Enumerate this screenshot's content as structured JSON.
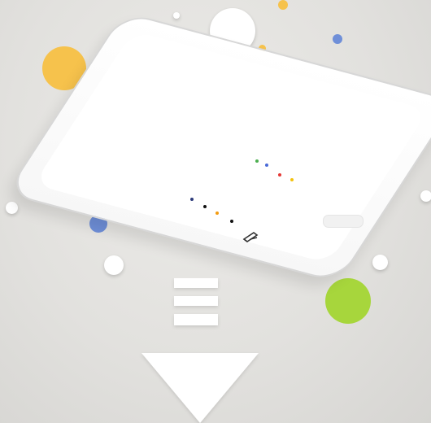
{
  "phone": {
    "screen_text": "",
    "home_indicator": ""
  },
  "icons": {
    "phone": "smartphone-icon",
    "down_arrow": "download-arrow-icon",
    "assistant_dots": "google-dots-icon"
  },
  "colors": {
    "background": "#e3e2df",
    "yellow": "#f6c24c",
    "blue": "#6f8fd8",
    "green": "#a7d63c",
    "white": "#ffffff"
  }
}
